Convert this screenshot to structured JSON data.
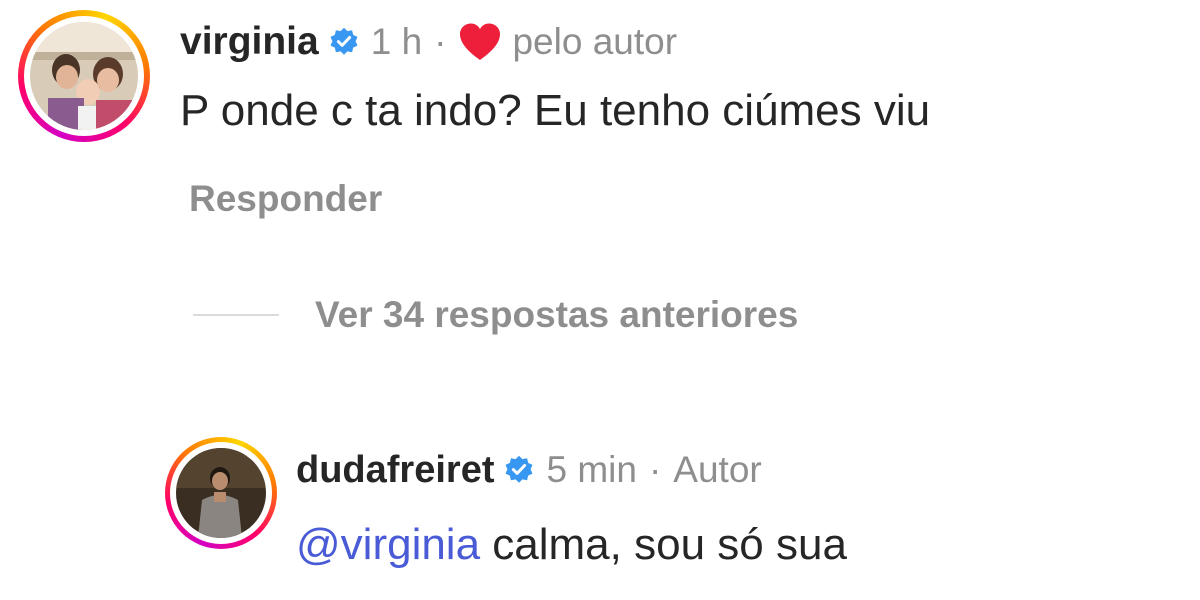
{
  "colors": {
    "text_primary": "#262626",
    "text_secondary": "#8e8e8e",
    "verified_blue": "#3897f0",
    "heart_red": "#ed1f3b",
    "mention_blue": "#4a5bd6"
  },
  "comment": {
    "username": "virginia",
    "verified": true,
    "time": "1 h",
    "separator": "·",
    "liked_by_author_label": "pelo autor",
    "text": "P onde c ta indo? Eu tenho ciúmes viu",
    "reply_label": "Responder",
    "view_replies_label": "Ver 34 respostas anteriores",
    "icons": [
      "verified-badge-icon",
      "heart-icon"
    ]
  },
  "reply": {
    "username": "dudafreiret",
    "verified": true,
    "time": "5 min",
    "separator": "·",
    "author_label": "Autor",
    "mention": "@virginia",
    "text": " calma, sou só sua"
  }
}
